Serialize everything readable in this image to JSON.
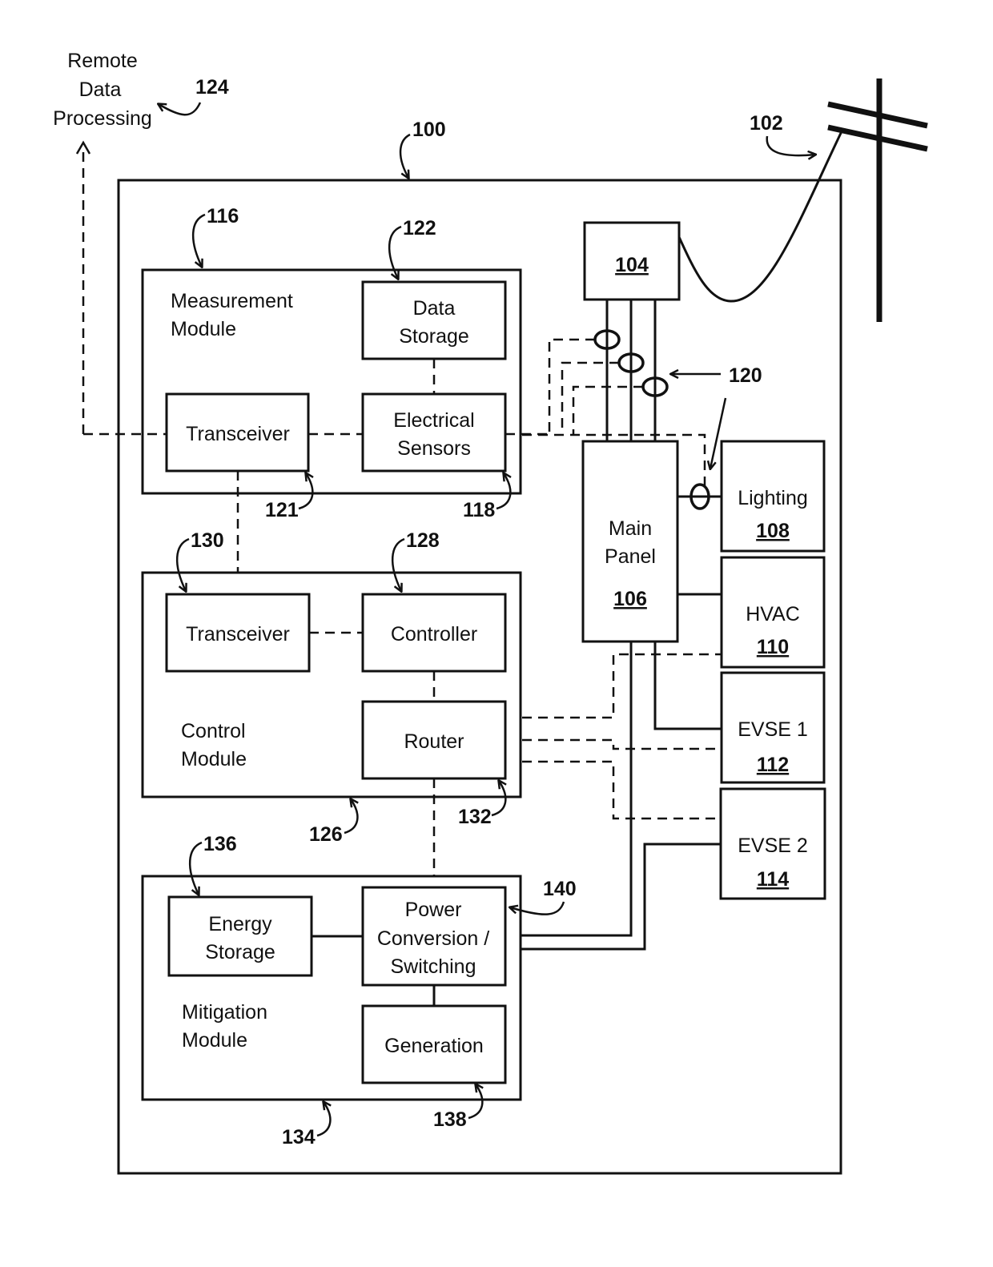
{
  "figure": {
    "external": {
      "remote_processing": {
        "lines": [
          "Remote",
          "Data",
          "Processing"
        ],
        "ref": "124"
      },
      "utility_pole_ref": "102",
      "system_ref": "100"
    },
    "meter": {
      "ref": "104"
    },
    "current_sensors_ref": "120",
    "main_panel": {
      "lines": [
        "Main",
        "Panel"
      ],
      "ref": "106"
    },
    "loads": [
      {
        "label": "Lighting",
        "ref": "108"
      },
      {
        "label": "HVAC",
        "ref": "110"
      },
      {
        "label": "EVSE 1",
        "ref": "112"
      },
      {
        "label": "EVSE 2",
        "ref": "114"
      }
    ],
    "measurement_module": {
      "lines": [
        "Measurement",
        "Module"
      ],
      "ref": "116",
      "data_storage": {
        "lines": [
          "Data",
          "Storage"
        ],
        "ref": "122"
      },
      "transceiver": {
        "label": "Transceiver",
        "ref": "121"
      },
      "electrical_sensors": {
        "lines": [
          "Electrical",
          "Sensors"
        ],
        "ref": "118"
      }
    },
    "control_module": {
      "lines": [
        "Control",
        "Module"
      ],
      "ref": "126",
      "transceiver": {
        "label": "Transceiver",
        "ref": "130"
      },
      "controller": {
        "label": "Controller",
        "ref": "128"
      },
      "router": {
        "label": "Router",
        "ref": "132"
      }
    },
    "mitigation_module": {
      "lines": [
        "Mitigation",
        "Module"
      ],
      "ref": "134",
      "energy_storage": {
        "lines": [
          "Energy",
          "Storage"
        ],
        "ref": "136"
      },
      "power_conversion": {
        "lines": [
          "Power",
          "Conversion /",
          "Switching"
        ],
        "ref": "140"
      },
      "generation": {
        "label": "Generation",
        "ref": "138"
      }
    }
  }
}
